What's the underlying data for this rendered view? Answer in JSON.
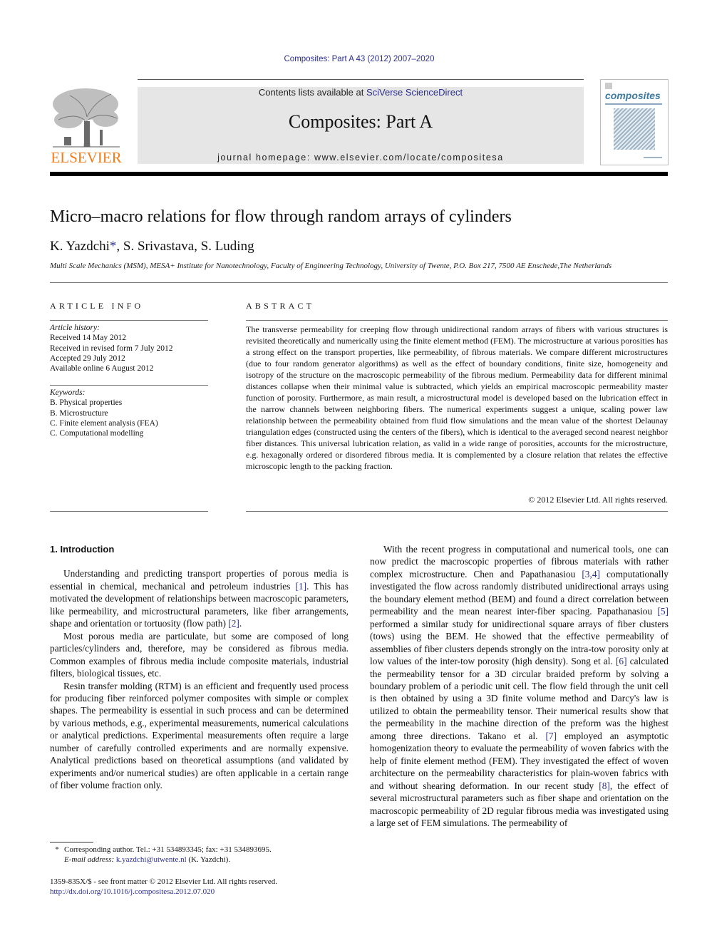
{
  "header": {
    "journal_ref": "Composites: Part A 43 (2012) 2007–2020",
    "contents_prefix": "Contents lists available at ",
    "contents_link": "SciVerse ScienceDirect",
    "journal_title": "Composites: Part A",
    "homepage": "journal homepage: www.elsevier.com/locate/compositesa",
    "publisher_logo": "ELSEVIER",
    "cover_title": "composites",
    "colors": {
      "link": "#2b2e8c",
      "publisher": "#f27b1a",
      "banner": "#e6e6e6"
    }
  },
  "article": {
    "title": "Micro–macro relations for flow through random arrays of cylinders",
    "authors": [
      {
        "name": "K. Yazdchi",
        "mark": "*"
      },
      {
        "name": ", S. Srivastava, S. Luding"
      }
    ],
    "affiliation": "Multi Scale Mechanics (MSM), MESA+ Institute for Nanotechnology, Faculty of Engineering Technology, University of Twente, P.O. Box 217, 7500 AE Enschede,The Netherlands"
  },
  "article_info": {
    "heading": "ARTICLE INFO",
    "history_label": "Article history:",
    "history": [
      "Received 14 May 2012",
      "Received in revised form 7 July 2012",
      "Accepted 29 July 2012",
      "Available online 6 August 2012"
    ],
    "keywords_label": "Keywords:",
    "keywords": [
      "B. Physical properties",
      "B. Microstructure",
      "C. Finite element analysis (FEA)",
      "C. Computational modelling"
    ]
  },
  "abstract": {
    "heading": "ABSTRACT",
    "text": "The transverse permeability for creeping flow through unidirectional random arrays of fibers with various structures is revisited theoretically and numerically using the finite element method (FEM). The microstructure at various porosities has a strong effect on the transport properties, like permeability, of fibrous materials. We compare different microstructures (due to four random generator algorithms) as well as the effect of boundary conditions, finite size, homogeneity and isotropy of the structure on the macroscopic permeability of the fibrous medium. Permeability data for different minimal distances collapse when their minimal value is subtracted, which yields an empirical macroscopic permeability master function of porosity. Furthermore, as main result, a microstructural model is developed based on the lubrication effect in the narrow channels between neighboring fibers. The numerical experiments suggest a unique, scaling power law relationship between the permeability obtained from fluid flow simulations and the mean value of the shortest Delaunay triangulation edges (constructed using the centers of the fibers), which is identical to the averaged second nearest neighbor fiber distances. This universal lubrication relation, as valid in a wide range of porosities, accounts for the microstructure, e.g. hexagonally ordered or disordered fibrous media. It is complemented by a closure relation that relates the effective microscopic length to the packing fraction.",
    "copyright": "© 2012 Elsevier Ltd. All rights reserved."
  },
  "body": {
    "section_heading": "1. Introduction",
    "left": {
      "p1": [
        "Understanding and predicting transport properties of porous media is essential in chemical, mechanical and petroleum industries ",
        "[1]",
        ". This has motivated the development of relationships between macroscopic parameters, like permeability, and microstructural parameters, like fiber arrangements, shape and orientation or tortuosity (flow path) ",
        "[2]",
        "."
      ],
      "p2": "Most porous media are particulate, but some are composed of long particles/cylinders and, therefore, may be considered as fibrous media. Common examples of fibrous media include composite materials, industrial filters, biological tissues, etc.",
      "p3": "Resin transfer molding (RTM) is an efficient and frequently used process for producing fiber reinforced polymer composites with simple or complex shapes. The permeability is essential in such process and can be determined by various methods, e.g., experimental measurements, numerical calculations or analytical predictions. Experimental measurements often require a large number of carefully controlled experiments and are normally expensive. Analytical predictions based on theoretical assumptions (and validated by experiments and/or numerical studies) are often applicable in a certain range of fiber volume fraction only."
    },
    "right": {
      "segments": [
        "With the recent progress in computational and numerical tools, one can now predict the macroscopic properties of fibrous materials with rather complex microstructure. Chen and Papathanasiou ",
        "[3,4]",
        " computationally investigated the flow across randomly distributed unidirectional arrays using the boundary element method (BEM) and found a direct correlation between permeability and the mean nearest inter-fiber spacing. Papathanasiou ",
        "[5]",
        " performed a similar study for unidirectional square arrays of fiber clusters (tows) using the BEM. He showed that the effective permeability of assemblies of fiber clusters depends strongly on the intra-tow porosity only at low values of the inter-tow porosity (high density). Song et al. ",
        "[6]",
        " calculated the permeability tensor for a 3D circular braided preform by solving a boundary problem of a periodic unit cell. The flow field through the unit cell is then obtained by using a 3D finite volume method and Darcy's law is utilized to obtain the permeability tensor. Their numerical results show that the permeability in the machine direction of the preform was the highest among three directions. Takano et al. ",
        "[7]",
        " employed an asymptotic homogenization theory to evaluate the permeability of woven fabrics with the help of finite element method (FEM). They investigated the effect of woven architecture on the permeability characteristics for plain-woven fabrics with and without shearing deformation. In our recent study ",
        "[8]",
        ", the effect of several microstructural parameters such as fiber shape and orientation on the macroscopic permeability of 2D regular fibrous media was investigated using a large set of FEM simulations. The permeability of"
      ]
    }
  },
  "footnote": {
    "mark": "*",
    "line1": "Corresponding author. Tel.: +31 534893345; fax: +31 534893695.",
    "email_label": "E-mail address:",
    "email": "k.yazdchi@utwente.nl",
    "email_suffix": " (K. Yazdchi)."
  },
  "issn": {
    "line": "1359-835X/$ - see front matter © 2012 Elsevier Ltd. All rights reserved.",
    "doi": "http://dx.doi.org/10.1016/j.compositesa.2012.07.020"
  }
}
